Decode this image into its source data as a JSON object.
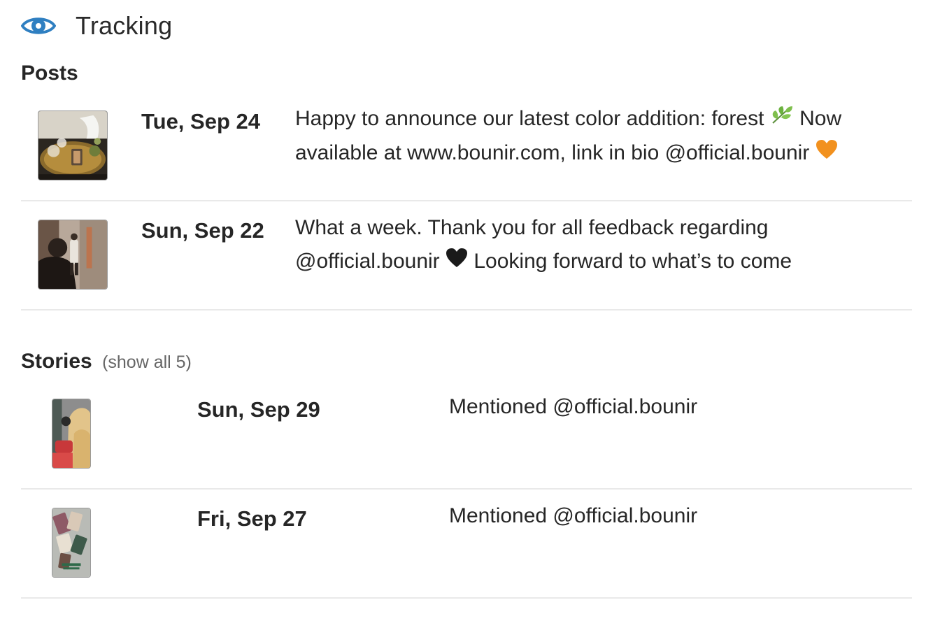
{
  "header": {
    "icon": "eye-icon",
    "title": "Tracking"
  },
  "posts": {
    "title": "Posts",
    "items": [
      {
        "date": "Tue, Sep 24",
        "caption_part1": "Happy to announce our latest color addition: forest",
        "caption_part2": "Now available at www.bounir.com, link in bio @official.bounir",
        "emoji_1": "leaf-emoji",
        "emoji_2": "orange-heart-emoji"
      },
      {
        "date": "Sun, Sep 22",
        "caption_part1": "What a week. Thank you for all feedback regarding @official.bounir",
        "caption_part2": "Looking forward to what’s to come",
        "emoji_1": "black-heart-emoji"
      }
    ]
  },
  "stories": {
    "title": "Stories",
    "show_all": "(show all 5)",
    "items": [
      {
        "date": "Sun, Sep 29",
        "caption": "Mentioned @official.bounir"
      },
      {
        "date": "Fri, Sep 27",
        "caption": "Mentioned @official.bounir"
      }
    ]
  },
  "colors": {
    "accent": "#2f7fc1",
    "text": "#262626",
    "muted": "#666666",
    "divider": "#e9e9e9"
  }
}
